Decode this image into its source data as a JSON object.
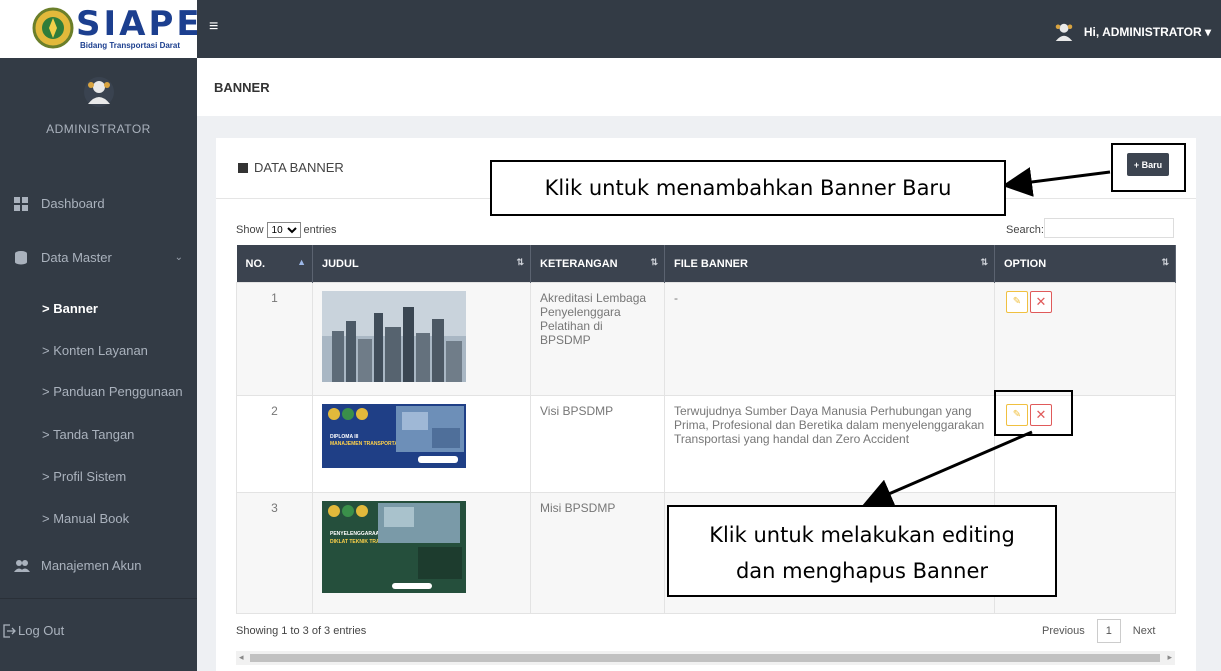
{
  "brand": {
    "title": "SIAPEL",
    "subtitle": "Bidang Transportasi Darat"
  },
  "sidebar": {
    "user_name": "ADMINISTRATOR",
    "items": [
      {
        "label": "Dashboard",
        "icon": "dashboard-icon"
      },
      {
        "label": "Data Master",
        "icon": "database-icon",
        "chevron": "⌄"
      },
      {
        "label": "> Banner",
        "active": true
      },
      {
        "label": "> Konten Layanan"
      },
      {
        "label": "> Panduan Penggunaan"
      },
      {
        "label": "> Tanda Tangan"
      },
      {
        "label": "> Profil Sistem"
      },
      {
        "label": "> Manual Book"
      },
      {
        "label": "Manajemen Akun",
        "icon": "users-icon"
      },
      {
        "label": "Log Out",
        "icon": "logout-icon"
      }
    ]
  },
  "topbar": {
    "menu_icon": "≡",
    "user_label": "Hi, ADMINISTRATOR ▾"
  },
  "page": {
    "title": "BANNER"
  },
  "panel": {
    "title": "DATA BANNER",
    "add_button": "+ Baru",
    "show_prefix": "Show",
    "show_value": "10",
    "show_suffix": "entries",
    "search_label": "Search:",
    "columns": [
      "NO.",
      "JUDUL",
      "KETERANGAN",
      "FILE BANNER",
      "OPTION"
    ],
    "rows": [
      {
        "no": "1",
        "keterangan": "Akreditasi Lembaga Penyelenggara Pelatihan di BPSDMP",
        "file": "-"
      },
      {
        "no": "2",
        "keterangan": "Visi BPSDMP",
        "file": "Terwujudnya Sumber Daya Manusia Perhubungan yang Prima, Profesional dan Beretika dalam menyelenggarakan Transportasi yang handal dan Zero Accident"
      },
      {
        "no": "3",
        "keterangan": "Misi BPSDMP",
        "file": ""
      }
    ],
    "banner2": {
      "heading1": "DIPLOMA III",
      "heading2": "MANAJEMEN TRANSPORTASI JALAN"
    },
    "banner3": {
      "heading1": "PENYELENGGARAAN",
      "heading2": "DIKLAT TEKNIK TRANSPORTASI DARAT"
    },
    "showing": "Showing 1 to 3 of 3 entries",
    "prev": "Previous",
    "page_num": "1",
    "next": "Next"
  },
  "annotations": {
    "add": "Klik untuk menambahkan Banner Baru",
    "edit_line1": "Klik untuk melakukan editing",
    "edit_line2": "dan menghapus Banner"
  }
}
